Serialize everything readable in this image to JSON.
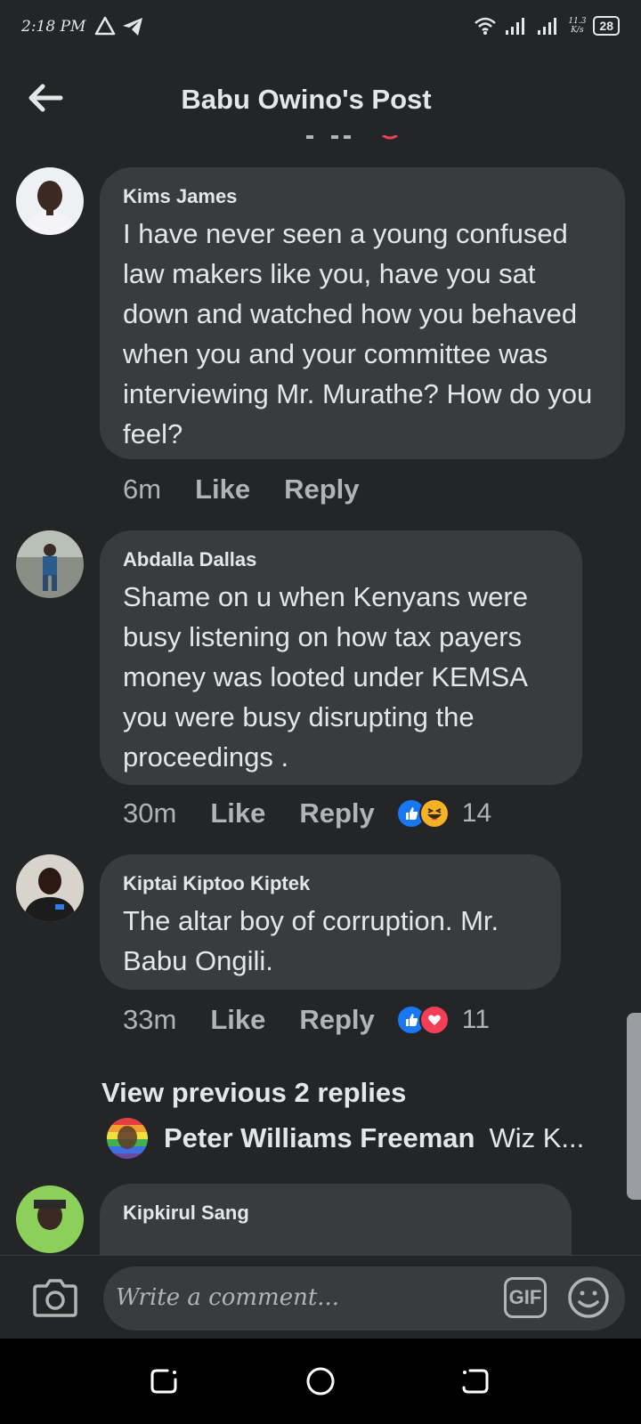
{
  "status_bar": {
    "time": "2:18 PM",
    "net_speed_top": "11.3",
    "net_speed_bottom": "K/s",
    "battery": "28"
  },
  "header": {
    "title": "Babu Owino's Post"
  },
  "comments": [
    {
      "author": "Kims James",
      "text": "I have never seen a young confused law makers like you, have you sat down and watched how you behaved when you and your committee was interviewing Mr. Murathe? How do you feel?",
      "time": "6m",
      "like": "Like",
      "reply": "Reply"
    },
    {
      "author": "Abdalla Dallas",
      "text": "Shame on u when Kenyans were busy listening on how tax payers money was looted under KEMSA you were busy disrupting the proceedings .",
      "time": "30m",
      "like": "Like",
      "reply": "Reply",
      "reactions": [
        "like",
        "haha"
      ],
      "reaction_count": "14"
    },
    {
      "author": "Kiptai Kiptoo Kiptek",
      "text": "The altar boy of corruption. Mr. Babu Ongili.",
      "time": "33m",
      "like": "Like",
      "reply": "Reply",
      "reactions": [
        "like",
        "love"
      ],
      "reaction_count": "11"
    },
    {
      "author": "Kipkirul Sang",
      "text": ""
    }
  ],
  "replies": {
    "view_previous": "View previous 2 replies",
    "preview_author": "Peter Williams Freeman",
    "preview_snippet": "Wiz K..."
  },
  "composer": {
    "placeholder": "Write a comment...",
    "gif_label": "GIF"
  },
  "colors": {
    "background": "#242527",
    "bubble": "#3a3b3c",
    "like_blue": "#1877f2",
    "love_red": "#f33e58",
    "haha_yellow": "#f7b125"
  },
  "icons": [
    "back-arrow-icon",
    "camera-icon",
    "gif-icon",
    "emoji-icon",
    "like-reaction-icon",
    "haha-reaction-icon",
    "love-reaction-icon",
    "recent-apps-icon",
    "home-icon",
    "back-nav-icon"
  ]
}
